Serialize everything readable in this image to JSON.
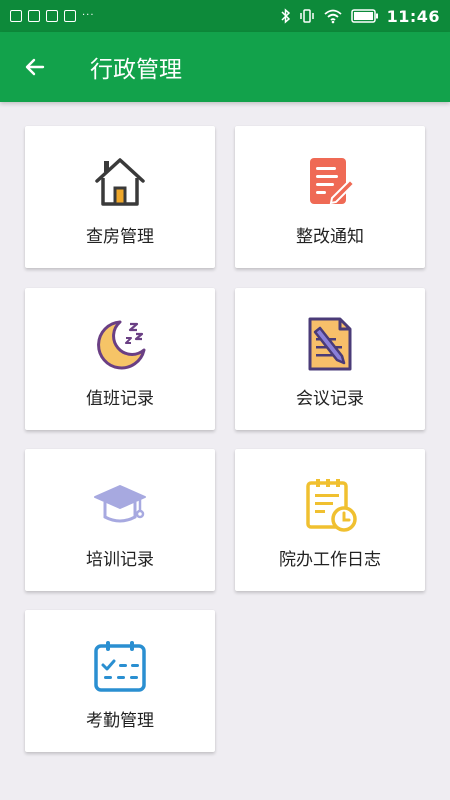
{
  "status_bar": {
    "time": "11:46",
    "overflow": "···"
  },
  "header": {
    "title": "行政管理",
    "back_icon": "arrow-left-icon"
  },
  "colors": {
    "status_bar": "#0d8a3a",
    "app_bar": "#12a24b",
    "background": "#efedf2"
  },
  "menu": {
    "items": [
      {
        "label": "查房管理",
        "icon": "house-icon"
      },
      {
        "label": "整改通知",
        "icon": "notice-edit-icon"
      },
      {
        "label": "值班记录",
        "icon": "moon-sleep-icon"
      },
      {
        "label": "会议记录",
        "icon": "document-pen-icon"
      },
      {
        "label": "培训记录",
        "icon": "graduation-cap-icon"
      },
      {
        "label": "院办工作日志",
        "icon": "log-clock-icon"
      },
      {
        "label": "考勤管理",
        "icon": "calendar-check-icon"
      }
    ]
  }
}
